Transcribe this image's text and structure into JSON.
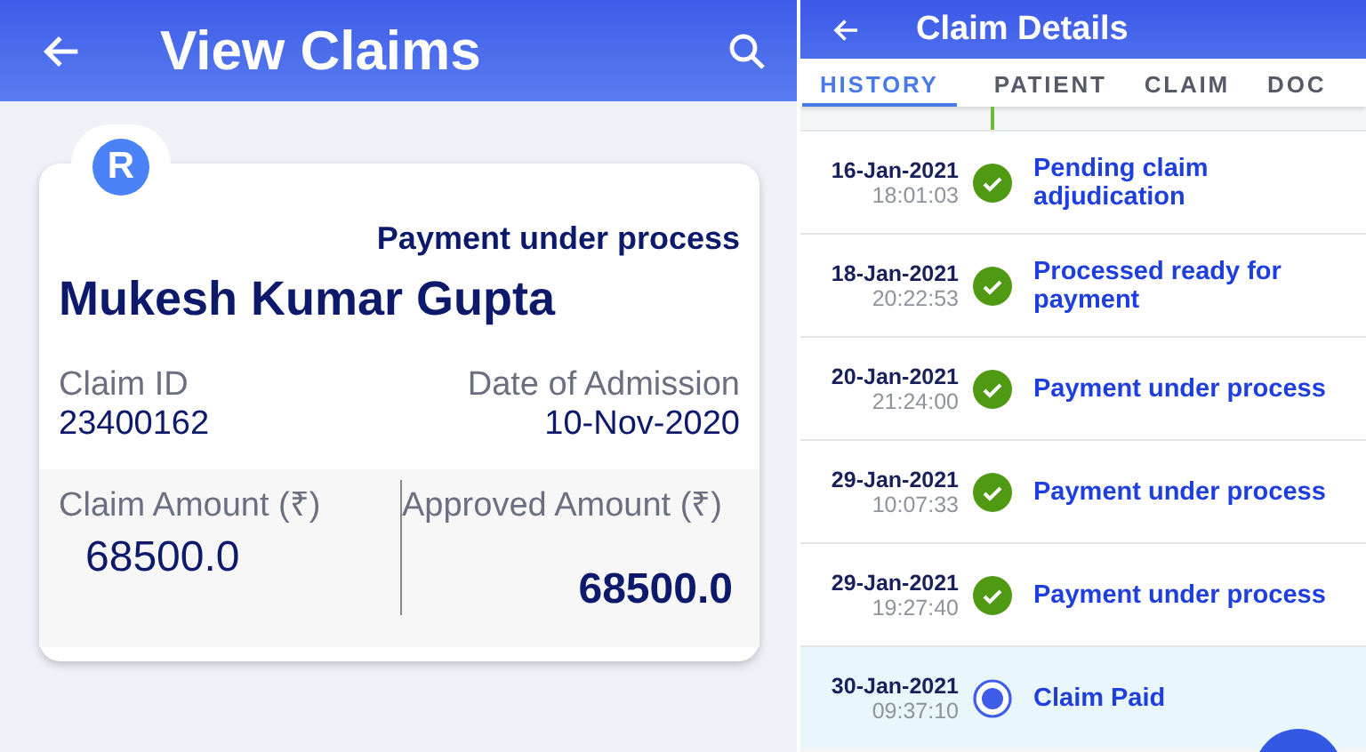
{
  "claims_screen": {
    "title": "View Claims",
    "claim_card": {
      "avatar_letter": "R",
      "status": "Payment under process",
      "patient_name": "Mukesh Kumar Gupta",
      "claim_id_label": "Claim ID",
      "claim_id": "23400162",
      "admission_label": "Date of Admission",
      "admission_date": "10-Nov-2020",
      "claim_amount_label": "Claim Amount (₹)",
      "claim_amount": "68500.0",
      "approved_amount_label": "Approved Amount (₹)",
      "approved_amount": "68500.0"
    }
  },
  "details_screen": {
    "title": "Claim Details",
    "tabs": [
      {
        "label": "HISTORY",
        "selected": true
      },
      {
        "label": "PATIENT",
        "selected": false
      },
      {
        "label": "CLAIM",
        "selected": false
      },
      {
        "label": "DOC",
        "selected": false
      }
    ],
    "history": [
      {
        "date": "16-Jan-2021",
        "time": "18:01:03",
        "event": "Pending claim adjudication",
        "kind": "done",
        "selected": false
      },
      {
        "date": "18-Jan-2021",
        "time": "20:22:53",
        "event": "Processed ready for payment",
        "kind": "done",
        "selected": false
      },
      {
        "date": "20-Jan-2021",
        "time": "21:24:00",
        "event": "Payment under process",
        "kind": "done",
        "selected": false
      },
      {
        "date": "29-Jan-2021",
        "time": "10:07:33",
        "event": "Payment under process",
        "kind": "done",
        "selected": false
      },
      {
        "date": "29-Jan-2021",
        "time": "19:27:40",
        "event": "Payment under process",
        "kind": "done",
        "selected": false
      },
      {
        "date": "30-Jan-2021",
        "time": "09:37:10",
        "event": "Claim Paid",
        "kind": "current",
        "selected": true
      }
    ]
  }
}
